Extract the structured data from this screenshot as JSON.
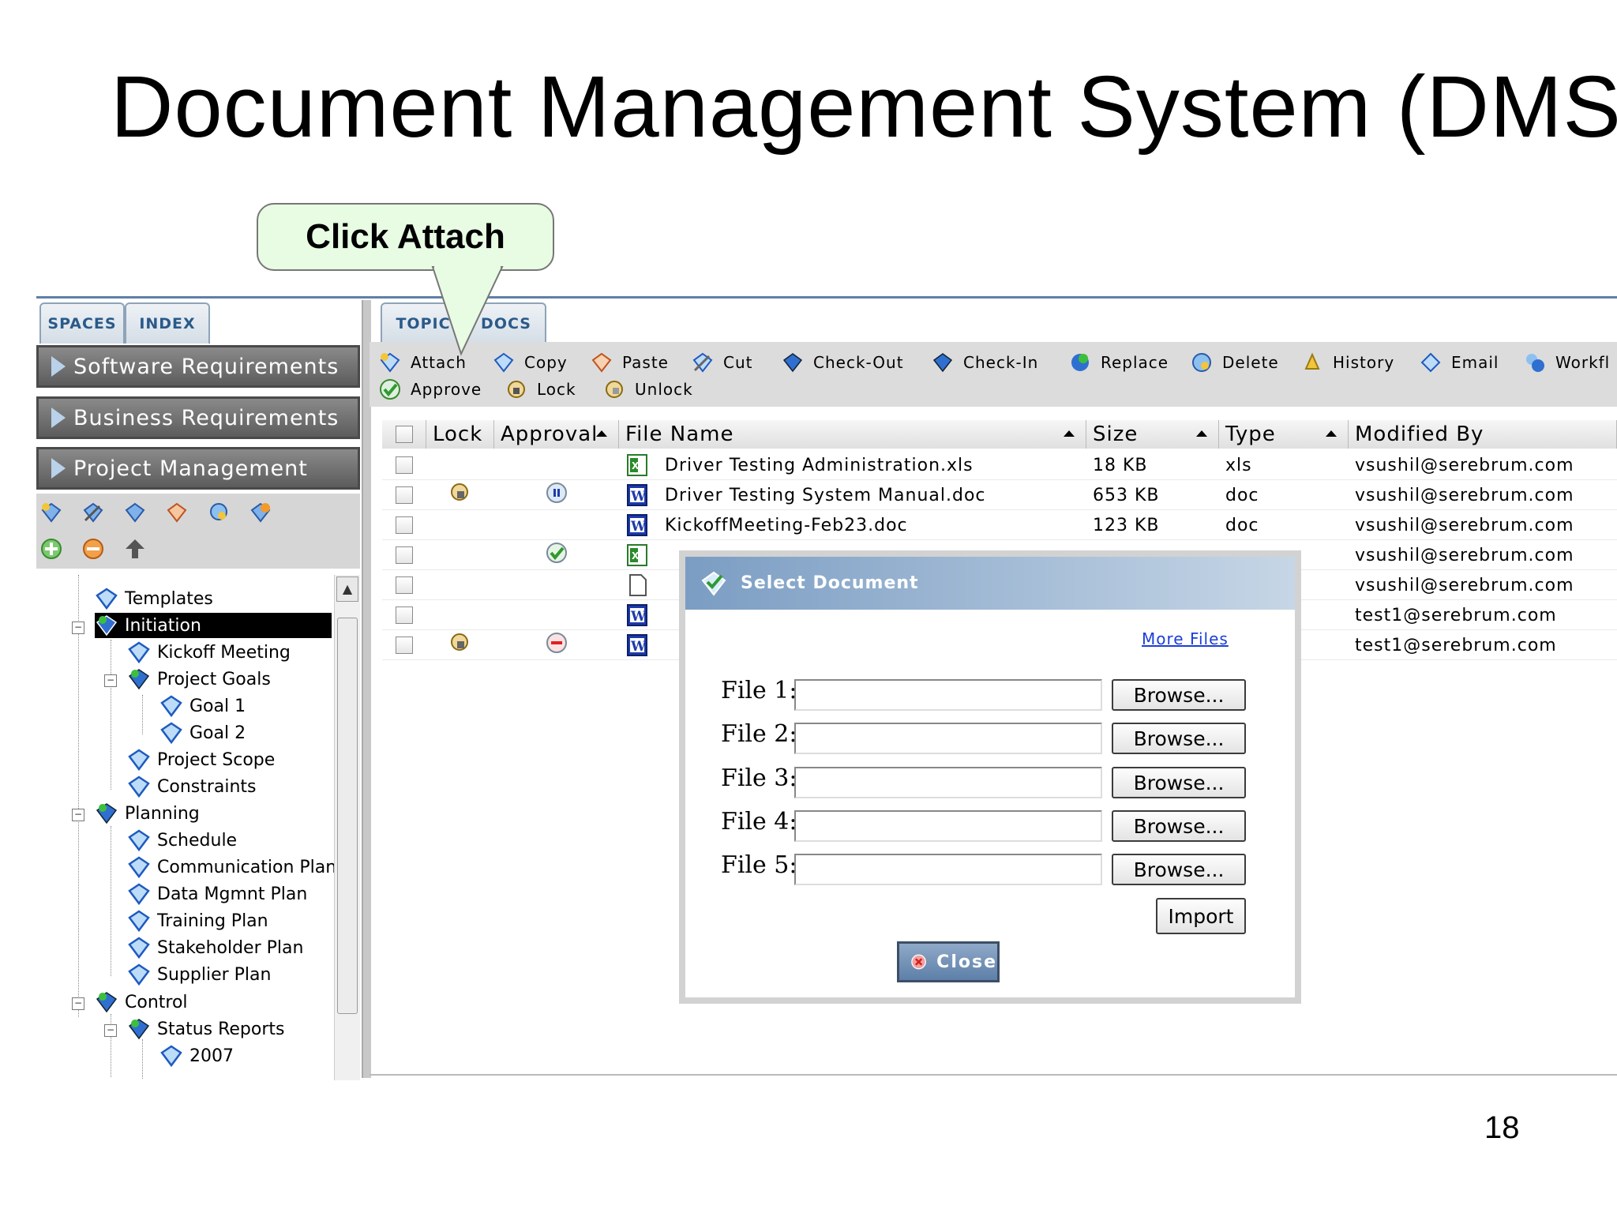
{
  "slide": {
    "title": "Document Management System (DMS)",
    "page_number": "18"
  },
  "callout": {
    "text": "Click Attach"
  },
  "left_panel": {
    "tabs": [
      "SPACES",
      "INDEX"
    ],
    "spaces": [
      "Software Requirements",
      "Business Requirements",
      "Project Management"
    ],
    "tree": [
      {
        "label": "Templates"
      },
      {
        "label": "Initiation"
      },
      {
        "label": "Kickoff Meeting"
      },
      {
        "label": "Project Goals"
      },
      {
        "label": "Goal 1"
      },
      {
        "label": "Goal 2"
      },
      {
        "label": "Project Scope"
      },
      {
        "label": "Constraints"
      },
      {
        "label": "Planning"
      },
      {
        "label": "Schedule"
      },
      {
        "label": "Communication Plan"
      },
      {
        "label": "Data Mgmnt Plan"
      },
      {
        "label": "Training Plan"
      },
      {
        "label": "Stakeholder Plan"
      },
      {
        "label": "Supplier Plan"
      },
      {
        "label": "Control"
      },
      {
        "label": "Status Reports"
      },
      {
        "label": "2007"
      }
    ]
  },
  "right_panel": {
    "tabs": [
      "TOPIC",
      "DOCS"
    ],
    "toolbar": [
      "Attach",
      "Copy",
      "Paste",
      "Cut",
      "Check-Out",
      "Check-In",
      "Replace",
      "Delete",
      "History",
      "Email",
      "Workfl",
      "Approve",
      "Lock",
      "Unlock"
    ],
    "columns": [
      "Lock",
      "Approval",
      "File Name",
      "Size",
      "Type",
      "Modified By"
    ],
    "rows": [
      {
        "file_name": "Driver Testing Administration.xls",
        "size": "18 KB",
        "type": "xls",
        "modified_by": "vsushil@serebrum.com",
        "icon": "excel-icon",
        "lock": "",
        "approval": ""
      },
      {
        "file_name": "Driver Testing System Manual.doc",
        "size": "653 KB",
        "type": "doc",
        "modified_by": "vsushil@serebrum.com",
        "icon": "word-icon",
        "lock": "lock-icon",
        "approval": "pending-icon"
      },
      {
        "file_name": "KickoffMeeting-Feb23.doc",
        "size": "123 KB",
        "type": "doc",
        "modified_by": "vsushil@serebrum.com",
        "icon": "word-icon",
        "lock": "",
        "approval": ""
      },
      {
        "file_name": "",
        "size": "",
        "type": "",
        "modified_by": "vsushil@serebrum.com",
        "icon": "excel-icon",
        "lock": "",
        "approval": "approved-icon"
      },
      {
        "file_name": "",
        "size": "",
        "type": "",
        "modified_by": "vsushil@serebrum.com",
        "icon": "blank-doc-icon",
        "lock": "",
        "approval": ""
      },
      {
        "file_name": "",
        "size": "",
        "type": "",
        "modified_by": "test1@serebrum.com",
        "icon": "word-icon",
        "lock": "",
        "approval": ""
      },
      {
        "file_name": "",
        "size": "",
        "type": "",
        "modified_by": "test1@serebrum.com",
        "icon": "word-icon",
        "lock": "lock-icon",
        "approval": "rejected-icon"
      }
    ]
  },
  "dialog": {
    "title": "Select Document",
    "more_files": "More Files",
    "files": [
      "File 1:",
      "File 2:",
      "File 3:",
      "File 4:",
      "File 5:"
    ],
    "browse_label": "Browse...",
    "import_label": "Import",
    "close_label": "Close"
  },
  "colors": {
    "accent": "#5f7fa8",
    "callout_bg": "#e8fbe3",
    "selected_bg": "#000000",
    "link": "#1a3fd6"
  }
}
